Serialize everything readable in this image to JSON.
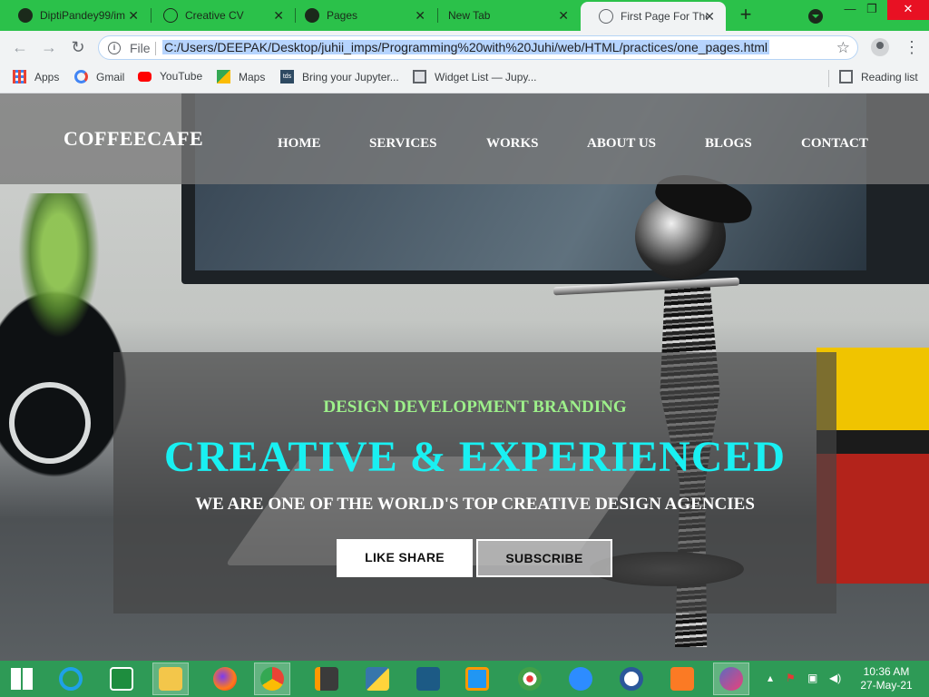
{
  "browser": {
    "tabs": [
      {
        "title": "DiptiPandey99/im",
        "icon": "github-icon",
        "active": false
      },
      {
        "title": "Creative CV",
        "icon": "globe-icon",
        "active": false
      },
      {
        "title": "Pages",
        "icon": "github-icon",
        "active": false
      },
      {
        "title": "New Tab",
        "icon": "",
        "active": false
      },
      {
        "title": "First Page For The",
        "icon": "globe-icon",
        "active": true
      }
    ],
    "address": {
      "scheme_label": "File",
      "url": "C:/Users/DEEPAK/Desktop/juhii_imps/Programming%20with%20Juhi/web/HTML/practices/one_pages.html"
    },
    "bookmarks": [
      {
        "label": "Apps",
        "icon": "apps-grid-icon"
      },
      {
        "label": "Gmail",
        "icon": "google-icon"
      },
      {
        "label": "YouTube",
        "icon": "youtube-icon"
      },
      {
        "label": "Maps",
        "icon": "maps-icon"
      },
      {
        "label": "Bring your Jupyter...",
        "icon": "tds-icon"
      },
      {
        "label": "Widget List — Jupy...",
        "icon": "widget-icon"
      }
    ],
    "reading_list": "Reading list",
    "tab_icon_text": "tds"
  },
  "site": {
    "logo": "COFFEECAFE",
    "nav": [
      "HOME",
      "SERVICES",
      "WORKS",
      "ABOUT US",
      "BLOGS",
      "CONTACT"
    ],
    "hero": {
      "subtitle": "DESIGN DEVELOPMENT BRANDING",
      "title": "CREATIVE & EXPERIENCED",
      "tagline": "WE ARE ONE OF THE WORLD'S TOP CREATIVE DESIGN AGENCIES",
      "primary_button": "LIKE SHARE",
      "secondary_button": "SUBSCRIBE"
    },
    "colors": {
      "subtitle": "#9df08a",
      "title": "#19f0f2",
      "nav_overlay": "#787878"
    }
  },
  "taskbar": {
    "apps": [
      "start-icon",
      "internet-explorer-icon",
      "store-icon",
      "file-explorer-icon",
      "firefox-icon",
      "chrome-icon",
      "sublime-text-icon",
      "python-icon",
      "mysql-icon",
      "media-player-icon",
      "paint-icon",
      "zoom-icon",
      "ms-access-icon",
      "xampp-icon",
      "paint3d-icon"
    ],
    "time": "10:36 AM",
    "date": "27-May-21"
  }
}
